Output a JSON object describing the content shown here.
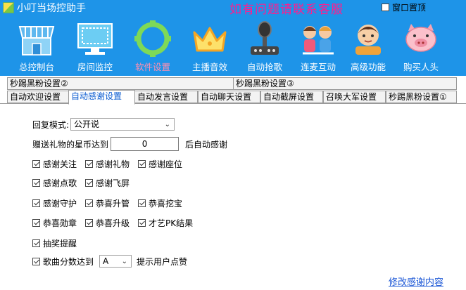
{
  "title": "小叮当场控助手",
  "banner": "如有问题请联系客服",
  "topmost_label": "窗口置顶",
  "topmost_checked": false,
  "toolbar": [
    {
      "id": "console",
      "label": "总控制台",
      "icon": "store-icon",
      "disabled": false
    },
    {
      "id": "room",
      "label": "房间监控",
      "icon": "monitor-icon",
      "disabled": false
    },
    {
      "id": "settings",
      "label": "软件设置",
      "icon": "gear-icon",
      "disabled": true
    },
    {
      "id": "anchor",
      "label": "主播音效",
      "icon": "crown-icon",
      "disabled": false
    },
    {
      "id": "grab",
      "label": "自动抢歌",
      "icon": "microphone-icon",
      "disabled": false
    },
    {
      "id": "mic",
      "label": "连麦互动",
      "icon": "kids-icon",
      "disabled": false
    },
    {
      "id": "advanced",
      "label": "高级功能",
      "icon": "child-icon",
      "disabled": false
    },
    {
      "id": "buy",
      "label": "购买人头",
      "icon": "pig-icon",
      "disabled": false
    }
  ],
  "tabs_row1": [
    "秒踢黑粉设置②",
    "秒踢黑粉设置③"
  ],
  "tabs_row2": [
    "自动欢迎设置",
    "自动感谢设置",
    "自动发言设置",
    "自动聊天设置",
    "自动截屏设置",
    "召唤大军设置",
    "秒踢黑粉设置①"
  ],
  "active_tab": "自动感谢设置",
  "form": {
    "reply_mode_label": "回复模式:",
    "reply_mode_value": "公开说",
    "gift_prefix": "赠送礼物的星币达到",
    "gift_value": "0",
    "gift_suffix": "后自动感谢",
    "checkboxes": [
      {
        "label": "感谢关注",
        "checked": true
      },
      {
        "label": "感谢礼物",
        "checked": true
      },
      {
        "label": "感谢座位",
        "checked": true
      },
      {
        "label": "感谢点歌",
        "checked": true
      },
      {
        "label": "感谢飞屏",
        "checked": true
      },
      {
        "label": "感谢守护",
        "checked": true
      },
      {
        "label": "恭喜升管",
        "checked": true
      },
      {
        "label": "恭喜挖宝",
        "checked": true
      },
      {
        "label": "恭喜勋章",
        "checked": true
      },
      {
        "label": "恭喜升级",
        "checked": true
      },
      {
        "label": "才艺PK结果",
        "checked": true
      },
      {
        "label": "抽奖提醒",
        "checked": true
      }
    ],
    "score_label": "歌曲分数达到",
    "score_checked": true,
    "score_value": "A",
    "score_suffix": "提示用户点赞",
    "edit_link": "修改感谢内容"
  }
}
